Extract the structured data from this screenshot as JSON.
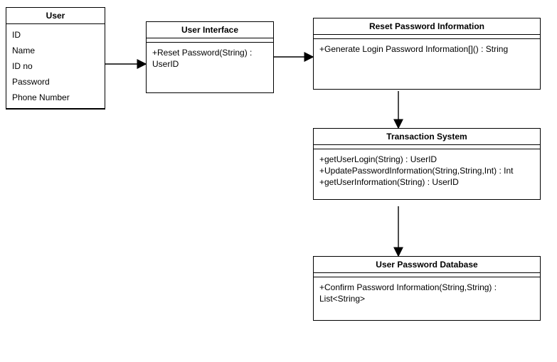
{
  "classes": {
    "user": {
      "title": "User",
      "attrs": [
        "ID",
        "Name",
        "ID no",
        "Password",
        "Phone Number"
      ],
      "ops": []
    },
    "ui": {
      "title": "User Interface",
      "attrs": [],
      "ops": [
        "+Reset Password(String) : UserID"
      ]
    },
    "reset": {
      "title": "Reset Password Information",
      "attrs": [],
      "ops": [
        "+Generate Login Password Information[]() : String"
      ]
    },
    "txn": {
      "title": "Transaction System",
      "attrs": [],
      "ops": [
        "+getUserLogin(String) : UserID",
        "+UpdatePasswordInformation(String,String,Int) : Int",
        "+getUserInformation(String) : UserID"
      ]
    },
    "db": {
      "title": "User Password Database",
      "attrs": [],
      "ops": [
        "+Confirm Password Information(String,String) : List<String>"
      ]
    }
  }
}
